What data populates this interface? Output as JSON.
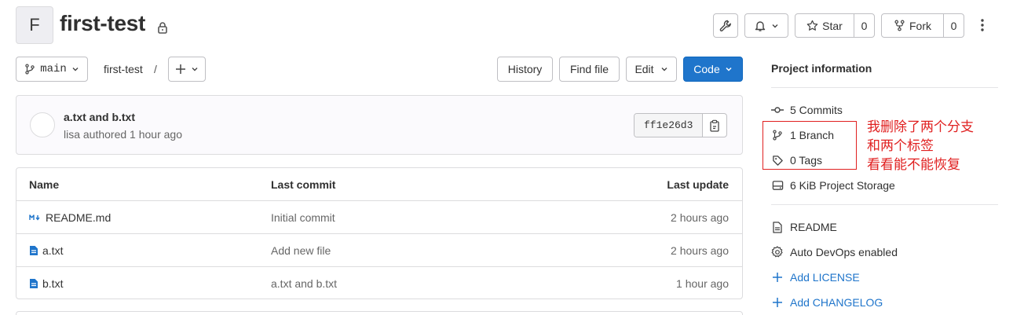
{
  "project": {
    "avatar_letter": "F",
    "name": "first-test"
  },
  "header_actions": {
    "star_label": "Star",
    "star_count": "0",
    "fork_label": "Fork",
    "fork_count": "0"
  },
  "toolbar": {
    "branch": "main",
    "breadcrumb": "first-test",
    "breadcrumb_sep": "/",
    "history": "History",
    "find_file": "Find file",
    "edit": "Edit",
    "code": "Code"
  },
  "last_commit": {
    "title": "a.txt and b.txt",
    "meta": "lisa authored 1 hour ago",
    "sha": "ff1e26d3"
  },
  "file_table": {
    "headers": {
      "name": "Name",
      "last_commit": "Last commit",
      "last_update": "Last update"
    },
    "rows": [
      {
        "name": "README.md",
        "icon": "markdown-icon",
        "commit": "Initial commit",
        "update": "2 hours ago"
      },
      {
        "name": "a.txt",
        "icon": "file-icon",
        "commit": "Add new file",
        "update": "2 hours ago"
      },
      {
        "name": "b.txt",
        "icon": "file-icon",
        "commit": "a.txt and b.txt",
        "update": "1 hour ago"
      }
    ]
  },
  "sidebar": {
    "title": "Project information",
    "stats": {
      "commits": "5 Commits",
      "branches": "1 Branch",
      "tags": "0 Tags",
      "storage": "6 KiB Project Storage"
    },
    "links": {
      "readme": "README",
      "devops": "Auto DevOps enabled",
      "add_license": "Add LICENSE",
      "add_changelog": "Add CHANGELOG"
    }
  },
  "annotation": {
    "lines": [
      "我删除了两个分支",
      "和两个标签",
      "看看能不能恢复"
    ],
    "color": "#e02020"
  },
  "colors": {
    "primary": "#1f75cb",
    "border": "#dcdcde"
  }
}
